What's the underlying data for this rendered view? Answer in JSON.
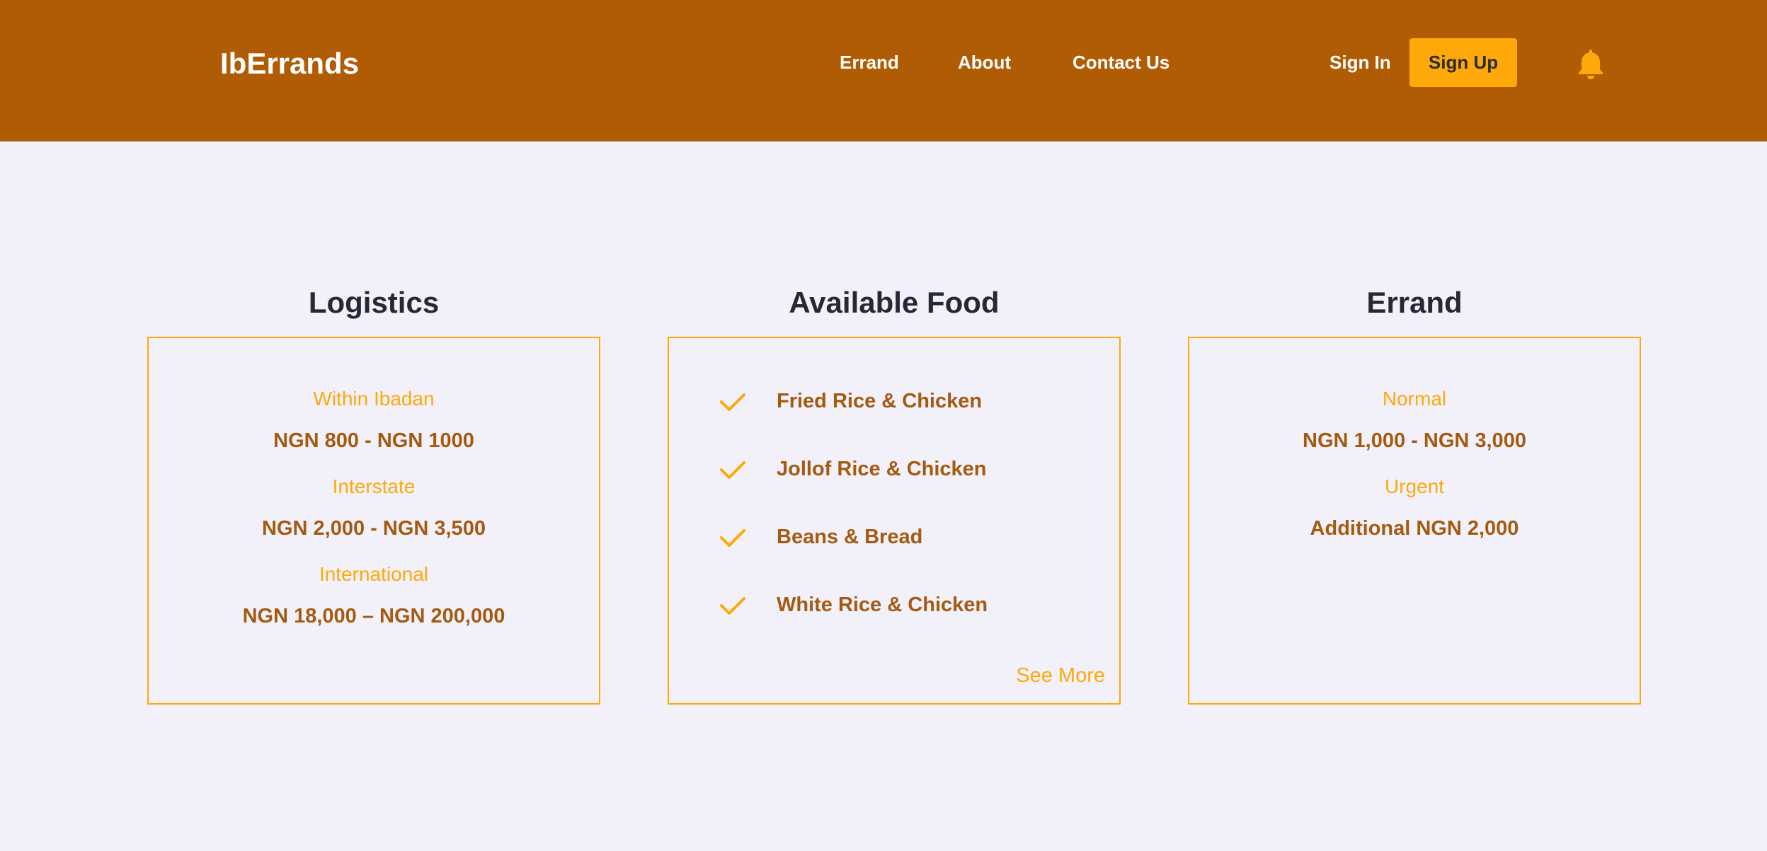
{
  "header": {
    "brand": "IbErrands",
    "nav": {
      "errand": "Errand",
      "about": "About",
      "contact": "Contact Us"
    },
    "sign_in": "Sign In",
    "sign_up": "Sign Up",
    "notification_icon": "bell-icon"
  },
  "logistics": {
    "title": "Logistics",
    "items": [
      {
        "label": "Within Ibadan",
        "price": "NGN 800 - NGN 1000"
      },
      {
        "label": "Interstate",
        "price": "NGN 2,000 - NGN 3,500"
      },
      {
        "label": "International",
        "price": "NGN 18,000 – NGN 200,000"
      }
    ]
  },
  "food": {
    "title": "Available Food",
    "items": [
      "Fried Rice & Chicken",
      "Jollof Rice & Chicken",
      "Beans & Bread",
      "White Rice & Chicken"
    ],
    "see_more": "See More"
  },
  "errand": {
    "title": "Errand",
    "items": [
      {
        "label": "Normal",
        "price": "NGN 1,000 - NGN 3,000"
      },
      {
        "label": "Urgent",
        "price": "Additional NGN 2,000"
      }
    ]
  },
  "colors": {
    "header_bg": "#b05c04",
    "accent": "#ffa80a",
    "price_text": "#a45a10",
    "page_bg": "#f2f1f9",
    "heading": "#252836"
  }
}
